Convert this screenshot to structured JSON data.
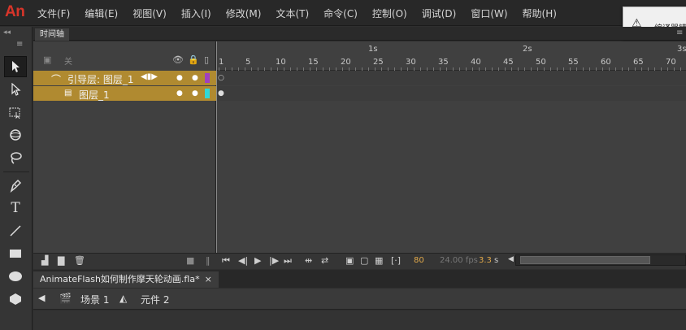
{
  "app": {
    "logo": "An"
  },
  "menu": [
    "文件(F)",
    "编辑(E)",
    "视图(V)",
    "插入(I)",
    "修改(M)",
    "文本(T)",
    "命令(C)",
    "控制(O)",
    "调试(D)",
    "窗口(W)",
    "帮助(H)"
  ],
  "warning": {
    "icon": "warning-icon",
    "text": "编译器错"
  },
  "timeline": {
    "tab_label": "时间轴",
    "header_label": "关",
    "seconds": [
      "1s",
      "2s",
      "3s"
    ],
    "frame_numbers": [
      "1",
      "5",
      "10",
      "15",
      "20",
      "25",
      "30",
      "35",
      "40",
      "45",
      "50",
      "55",
      "60",
      "65",
      "70"
    ],
    "layers": [
      {
        "name": "引导层: 图层_1",
        "type": "guide",
        "color": "#a040c0"
      },
      {
        "name": "图层_1",
        "type": "normal",
        "color": "#30d8d8"
      }
    ],
    "footer": {
      "current_frame": "80",
      "fps": "24.00 fps",
      "time": "3.3",
      "time_unit": "s"
    }
  },
  "document": {
    "tab_title": "AnimateFlash如何制作摩天轮动画.fla*",
    "close": "×"
  },
  "breadcrumb": {
    "scene_label": "场景 1",
    "symbol_label": "元件 2"
  }
}
